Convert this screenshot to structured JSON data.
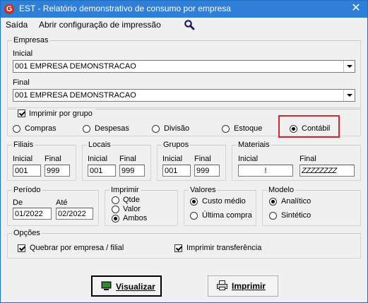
{
  "window": {
    "title": "EST - Relatório demonstrativo de consumo por empresa",
    "app_icon_letter": "G",
    "close_glyph": "✕"
  },
  "menu": {
    "saida": "Saída",
    "abrir_config": "Abrir configuração de impressão"
  },
  "empresas": {
    "legend": "Empresas",
    "inicial_label": "Inicial",
    "inicial_value": "001 EMPRESA DEMONSTRACAO",
    "final_label": "Final",
    "final_value": "001 EMPRESA DEMONSTRACAO"
  },
  "imprimir_por_grupo": {
    "label": "Imprimir por grupo",
    "checked": true,
    "options": [
      "Compras",
      "Despesas",
      "Divisão",
      "Estoque",
      "Contábil"
    ],
    "selected": "Contábil"
  },
  "filiais": {
    "legend": "Filiais",
    "inicial_label": "Inicial",
    "final_label": "Final",
    "inicial": "001",
    "final": "999"
  },
  "locais": {
    "legend": "Locais",
    "inicial_label": "Inicial",
    "final_label": "Final",
    "inicial": "001",
    "final": "999"
  },
  "grupos": {
    "legend": "Grupos",
    "inicial_label": "Inicial",
    "final_label": "Final",
    "inicial": "001",
    "final": "999"
  },
  "materiais": {
    "legend": "Materiais",
    "inicial_label": "Inicial",
    "final_label": "Final",
    "inicial": "!",
    "final": "ZZZZZZZZ"
  },
  "periodo": {
    "legend": "Período",
    "de_label": "De",
    "ate_label": "Até",
    "de": "01/2022",
    "ate": "02/2022"
  },
  "imprimir": {
    "legend": "Imprimir",
    "options": [
      "Qtde",
      "Valor",
      "Ambos"
    ],
    "selected": "Ambos"
  },
  "valores": {
    "legend": "Valores",
    "options": [
      "Custo médio",
      "Última compra"
    ],
    "selected": "Custo médio"
  },
  "modelo": {
    "legend": "Modelo",
    "options": [
      "Analítico",
      "Sintético"
    ],
    "selected": "Analítico"
  },
  "opcoes": {
    "legend": "Opções",
    "quebrar_label": "Quebrar por empresa / filial",
    "quebrar_checked": true,
    "transferencia_label": "Imprimir transferência",
    "transferencia_checked": true
  },
  "buttons": {
    "visualizar": "Visualizar",
    "imprimir": "Imprimir"
  },
  "colors": {
    "titlebar": "#2f7fd6",
    "highlight": "#d8282f",
    "app_icon": "#d52b1e"
  }
}
